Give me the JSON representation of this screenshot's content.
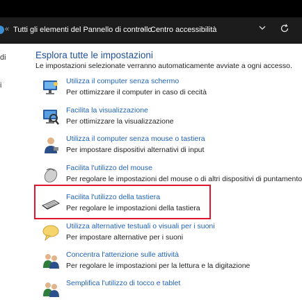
{
  "address_bar": {
    "separator_start": "«",
    "crumb_1": "Tutti gli elementi del Pannello di controllo",
    "separator": "›",
    "crumb_2": "Centro accessibilità",
    "dropdown_icon": "chevron-down-icon",
    "refresh_icon": "refresh-icon"
  },
  "left_pane_fragments": [
    "di",
    "i"
  ],
  "main": {
    "heading": "Esplora tutte le impostazioni",
    "subheading": "Le impostazioni selezionate verranno automaticamente avviate a ogni accesso.",
    "items": [
      {
        "title": "Utilizza il computer senza schermo",
        "description": "Per ottimizzare il computer in caso di cecità",
        "icon": "monitor-icon"
      },
      {
        "title": "Facilita la visualizzazione",
        "description": "Per ottimizzare la visualizzazione",
        "icon": "display-icon"
      },
      {
        "title": "Utilizza il computer senza mouse o tastiera",
        "description": "Per impostare dispositivi alternativi di input",
        "icon": "user-icon"
      },
      {
        "title": "Facilita l'utilizzo del mouse",
        "description": "Per regolare le impostazioni del mouse o di altri dispositivi di puntamento",
        "icon": "mouse-icon"
      },
      {
        "title": "Facilita l'utilizzo della tastiera",
        "description": "Per regolare le impostazioni della tastiera",
        "icon": "keyboard-icon"
      },
      {
        "title": "Utilizza alternative testuali o visuali per i suoni",
        "description": "Per impostare alternative per i suoni",
        "icon": "speech-bubble-icon"
      },
      {
        "title": "Concentra l'attenzione sulle attività",
        "description": "Per regolare le impostazioni per la lettura e la digitazione",
        "icon": "people-icon"
      },
      {
        "title": "Semplifica l'utilizzo di tocco e tablet",
        "description": "",
        "icon": "people-icon"
      }
    ]
  },
  "colors": {
    "link": "#1f62b8",
    "heading": "#1e4f9c",
    "highlight_border": "#e0142d",
    "address_bar_bg": "#1c1c1c"
  }
}
